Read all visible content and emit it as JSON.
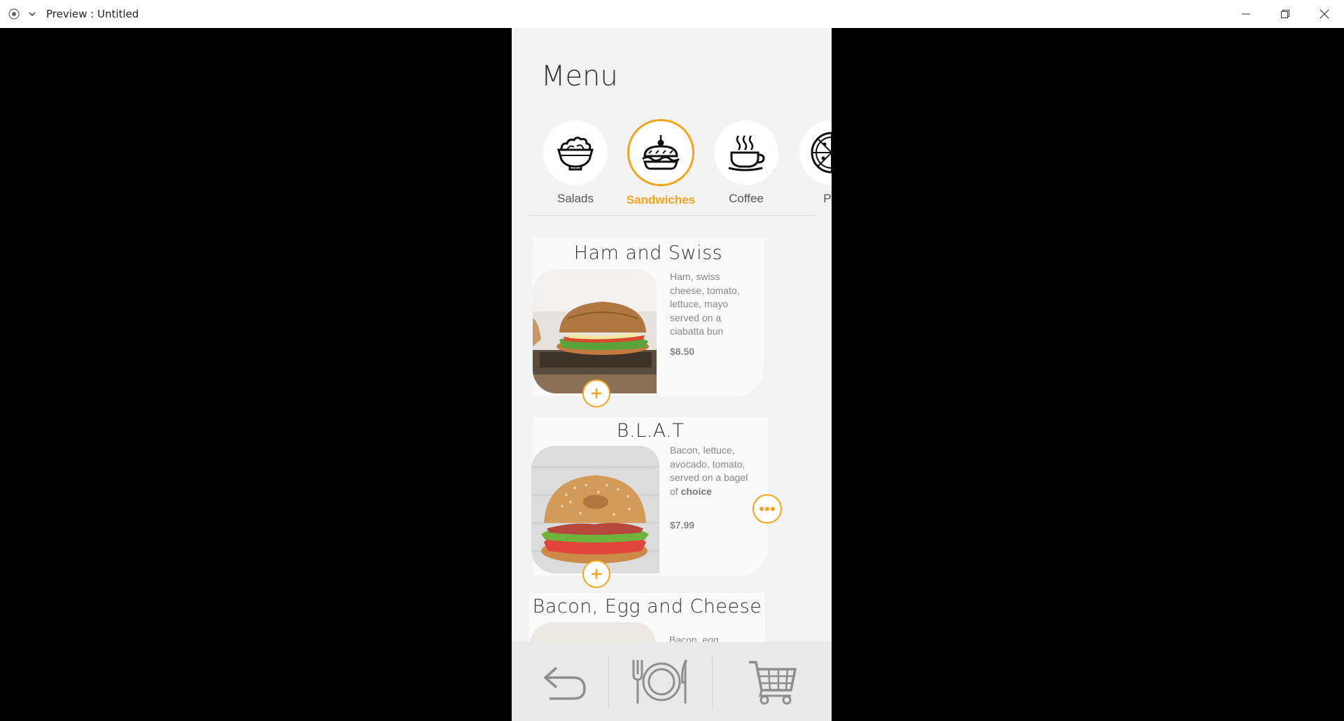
{
  "window": {
    "title": "Preview : Untitled"
  },
  "menu": {
    "title": "Menu"
  },
  "categories": [
    {
      "label": "Salads",
      "icon": "salad-bowl-icon",
      "active": false
    },
    {
      "label": "Sandwiches",
      "icon": "sandwich-icon",
      "active": true
    },
    {
      "label": "Coffee",
      "icon": "coffee-cup-icon",
      "active": false
    },
    {
      "label": "Piz",
      "icon": "pizza-icon",
      "active": false
    }
  ],
  "items": [
    {
      "name": "Ham and Swiss",
      "description": "Ham, swiss cheese, tomato, lettuce, mayo served on a ciabatta bun",
      "price": "$8.50"
    },
    {
      "name": "B.L.A.T",
      "description": "Bacon, lettuce, avocado, tomato, served on a bagel of",
      "description_bold": "choice",
      "price": "$7.99"
    },
    {
      "name": "Bacon, Egg and Cheese",
      "description": "Bacon, egg,"
    }
  ],
  "colors": {
    "accent": "#f7a21b",
    "background": "#f3f3f3",
    "bottom_bar": "#e9e9e9"
  },
  "bottom_nav": [
    {
      "icon": "back-arrow-icon"
    },
    {
      "icon": "plate-cutlery-icon"
    },
    {
      "icon": "shopping-cart-icon"
    }
  ]
}
